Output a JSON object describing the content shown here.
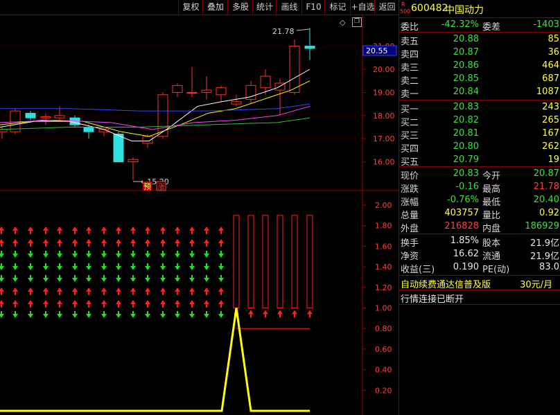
{
  "toolbar": {
    "buttons": [
      "复权",
      "叠加",
      "多股",
      "统计",
      "画线",
      "F10",
      "标记",
      "+自选",
      "返回"
    ]
  },
  "chart": {
    "price_axis": [
      "21.00",
      "20.00",
      "19.00",
      "18.00",
      "17.00",
      "16.00"
    ],
    "current_price_tag": "20.55",
    "high_annotation": "21.78",
    "low_annotation": "15.20",
    "tags": [
      "预",
      "涨"
    ],
    "indicator_axis": [
      "2.00",
      "1.80",
      "1.60",
      "1.40",
      "1.20",
      "1.00",
      "0.80",
      "0.60",
      "0.40",
      "0.20"
    ],
    "colors": {
      "up": "#ff3030",
      "down": "#30e0e0",
      "ma5": "#ffffff",
      "ma10": "#ffff00",
      "ma20": "#ff40ff",
      "ma60": "#4040ff",
      "ma120": "#30c030",
      "indicator": "#ffff00"
    }
  },
  "quote": {
    "r_badge": "R",
    "code_badge": "500",
    "code": "600482",
    "name": "中国动力",
    "weibi_label": "委比",
    "weibi_value": "-42.32%",
    "weicha_label": "委差",
    "weicha_value": "-1403",
    "sells": [
      {
        "label": "卖五",
        "price": "20.88",
        "vol": "85"
      },
      {
        "label": "卖四",
        "price": "20.87",
        "vol": "36"
      },
      {
        "label": "卖三",
        "price": "20.86",
        "vol": "464"
      },
      {
        "label": "卖二",
        "price": "20.85",
        "vol": "687"
      },
      {
        "label": "卖一",
        "price": "20.84",
        "vol": "1087"
      }
    ],
    "buys": [
      {
        "label": "买一",
        "price": "20.83",
        "vol": "243"
      },
      {
        "label": "买二",
        "price": "20.82",
        "vol": "265"
      },
      {
        "label": "买三",
        "price": "20.81",
        "vol": "167"
      },
      {
        "label": "买四",
        "price": "20.80",
        "vol": "262"
      },
      {
        "label": "买五",
        "price": "20.79",
        "vol": "19"
      }
    ],
    "stats": [
      {
        "l1": "现价",
        "v1": "20.83",
        "c1": "grn",
        "l2": "今开",
        "v2": "20.87",
        "c2": "grn"
      },
      {
        "l1": "涨跌",
        "v1": "-0.16",
        "c1": "grn",
        "l2": "最高",
        "v2": "21.78",
        "c2": "red"
      },
      {
        "l1": "涨幅",
        "v1": "-0.76%",
        "c1": "grn",
        "l2": "最低",
        "v2": "20.40",
        "c2": "grn"
      },
      {
        "l1": "总量",
        "v1": "403757",
        "c1": "yel",
        "l2": "量比",
        "v2": "0.92",
        "c2": "yel"
      },
      {
        "l1": "外盘",
        "v1": "216828",
        "c1": "red",
        "l2": "内盘",
        "v2": "186929",
        "c2": "grn"
      }
    ],
    "stats2": [
      {
        "l1": "换手",
        "v1": "1.85%",
        "l2": "股本",
        "v2": "21.9亿"
      },
      {
        "l1": "净资",
        "v1": "16.62",
        "l2": "流通",
        "v2": "21.9亿"
      },
      {
        "l1": "收益(三)",
        "v1": "0.190",
        "l2": "PE(动)",
        "v2": "83.0"
      }
    ],
    "ad_text": "自动续费通达信普及版",
    "ad_price": "30元/月",
    "status": "行情连接已断开"
  }
}
